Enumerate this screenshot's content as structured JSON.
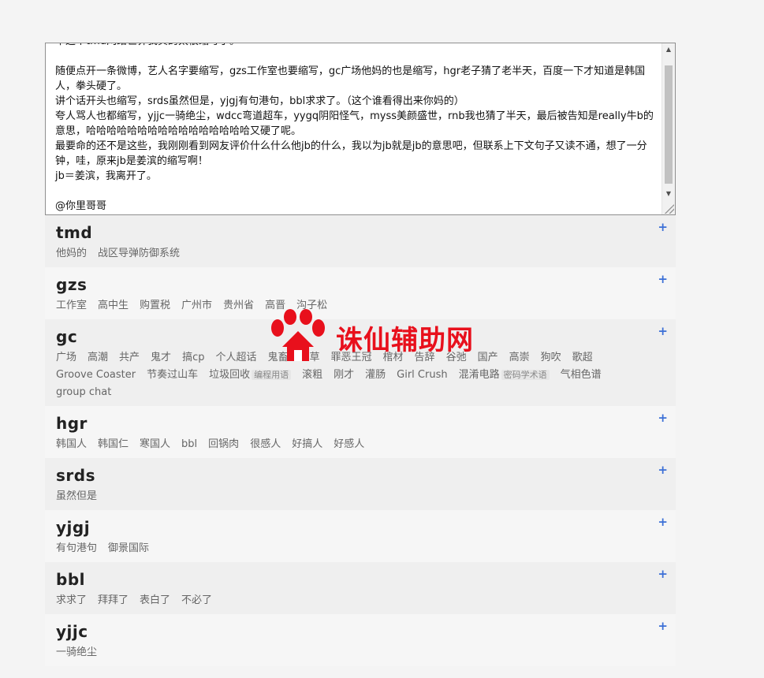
{
  "editor": {
    "text": "草这个tmd网络世界我真的太很缩写了。\n\n随便点开一条微博，艺人名字要缩写，gzs工作室也要缩写，gc广场他妈的也是缩写，hgr老子猜了老半天，百度一下才知道是韩国人，拳头硬了。\n讲个话开头也缩写，srds虽然但是，yjgj有句港句，bbl求求了。（这个谁看得出来你妈的）\n夸人骂人也都缩写，yjjc一骑绝尘，wdcc弯道超车，yygq阴阳怪气，myss美颜盛世，rnb我也猜了半天，最后被告知是really牛b的意思，哈哈哈哈哈哈哈哈哈哈哈哈哈哈哈哈又硬了呢。\n最要命的还不是这些，我刚刚看到网友评价什么什么他jb的什么，我以为jb就是jb的意思吧，但联系上下文句子又读不通，想了一分钟，哇，原来jb是姜滨的缩写啊！\njb＝姜滨，我离开了。\n\n@你里哥哥"
  },
  "add_label": "+",
  "entries": [
    {
      "term": "tmd",
      "meanings": [
        {
          "text": "他妈的"
        },
        {
          "text": "战区导弹防御系统"
        }
      ]
    },
    {
      "term": "gzs",
      "meanings": [
        {
          "text": "工作室"
        },
        {
          "text": "高中生"
        },
        {
          "text": "购置税"
        },
        {
          "text": "广州市"
        },
        {
          "text": "贵州省"
        },
        {
          "text": "高晋"
        },
        {
          "text": "沟子松"
        }
      ]
    },
    {
      "term": "gc",
      "meanings": [
        {
          "text": "广场"
        },
        {
          "text": "高潮"
        },
        {
          "text": "共产"
        },
        {
          "text": "鬼才"
        },
        {
          "text": "搞cp"
        },
        {
          "text": "个人超话"
        },
        {
          "text": "鬼畜"
        },
        {
          "text": "过草"
        },
        {
          "text": "罪恶王冠"
        },
        {
          "text": "棺材"
        },
        {
          "text": "告辞"
        },
        {
          "text": "谷弛"
        },
        {
          "text": "国产"
        },
        {
          "text": "高崇"
        },
        {
          "text": "狗吹"
        },
        {
          "text": "歌超"
        },
        {
          "text": "Groove Coaster"
        },
        {
          "text": "节奏过山车"
        },
        {
          "text": "垃圾回收",
          "tag": "编程用语"
        },
        {
          "text": "滚粗"
        },
        {
          "text": "刚才"
        },
        {
          "text": "灌肠"
        },
        {
          "text": "Girl Crush"
        },
        {
          "text": "混淆电路",
          "tag": "密码学术语"
        },
        {
          "text": "气相色谱"
        },
        {
          "text": "group chat"
        }
      ]
    },
    {
      "term": "hgr",
      "meanings": [
        {
          "text": "韩国人"
        },
        {
          "text": "韩国仁"
        },
        {
          "text": "寒国人"
        },
        {
          "text": "bbl"
        },
        {
          "text": "回锅肉"
        },
        {
          "text": "很感人"
        },
        {
          "text": "好搞人"
        },
        {
          "text": "好感人"
        }
      ]
    },
    {
      "term": "srds",
      "meanings": [
        {
          "text": "虽然但是"
        }
      ]
    },
    {
      "term": "yjgj",
      "meanings": [
        {
          "text": "有句港句"
        },
        {
          "text": "御景国际"
        }
      ]
    },
    {
      "term": "bbl",
      "meanings": [
        {
          "text": "求求了"
        },
        {
          "text": "拜拜了"
        },
        {
          "text": "表白了"
        },
        {
          "text": "不必了"
        }
      ]
    },
    {
      "term": "yjjc",
      "meanings": [
        {
          "text": "一骑绝尘"
        }
      ]
    }
  ],
  "watermark": {
    "text": "诛仙辅助网",
    "color": "#e8101c"
  }
}
